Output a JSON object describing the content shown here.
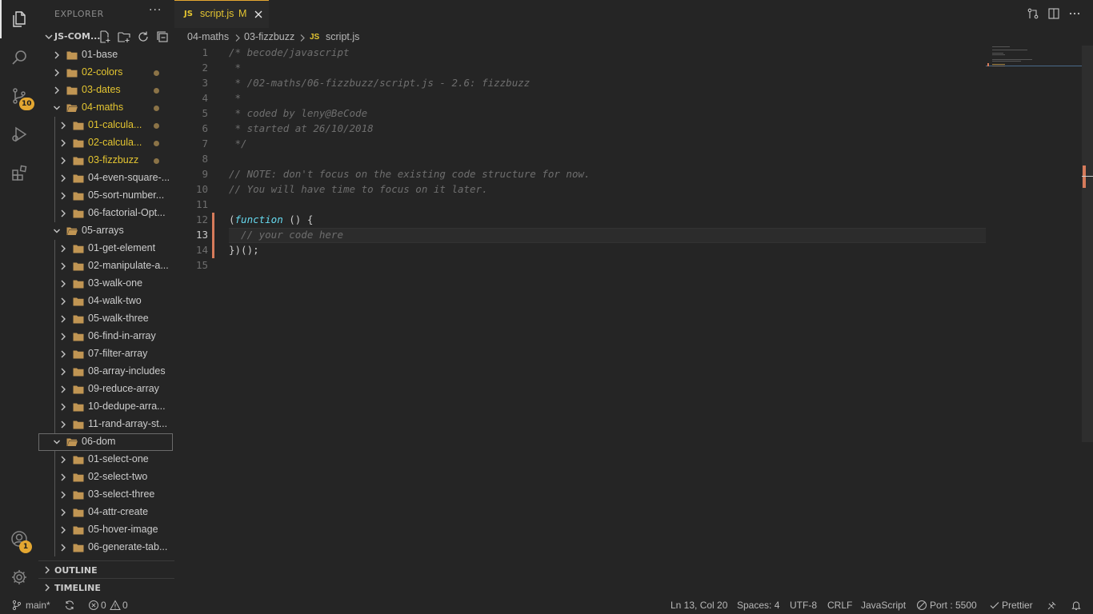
{
  "activity_bar": {
    "source_control_badge": "10",
    "accounts_badge": "1",
    "icons": [
      "explorer-icon",
      "search-icon",
      "source-control-icon",
      "run-debug-icon",
      "extensions-icon",
      "accounts-icon",
      "settings-gear-icon"
    ]
  },
  "sidebar": {
    "title": "EXPLORER",
    "more": "···",
    "workspace": "JS-COM...",
    "tree": [
      {
        "label": "01-base",
        "depth": 0,
        "open": false,
        "modified": false
      },
      {
        "label": "02-colors",
        "depth": 0,
        "open": false,
        "modified": true
      },
      {
        "label": "03-dates",
        "depth": 0,
        "open": false,
        "modified": true
      },
      {
        "label": "04-maths",
        "depth": 0,
        "open": true,
        "modified": true
      },
      {
        "label": "01-calcula...",
        "depth": 1,
        "open": false,
        "modified": true
      },
      {
        "label": "02-calcula...",
        "depth": 1,
        "open": false,
        "modified": true
      },
      {
        "label": "03-fizzbuzz",
        "depth": 1,
        "open": false,
        "modified": true
      },
      {
        "label": "04-even-square-...",
        "depth": 1,
        "open": false,
        "modified": false
      },
      {
        "label": "05-sort-number...",
        "depth": 1,
        "open": false,
        "modified": false
      },
      {
        "label": "06-factorial-Opt...",
        "depth": 1,
        "open": false,
        "modified": false
      },
      {
        "label": "05-arrays",
        "depth": 0,
        "open": true,
        "modified": false
      },
      {
        "label": "01-get-element",
        "depth": 1,
        "open": false,
        "modified": false
      },
      {
        "label": "02-manipulate-a...",
        "depth": 1,
        "open": false,
        "modified": false
      },
      {
        "label": "03-walk-one",
        "depth": 1,
        "open": false,
        "modified": false
      },
      {
        "label": "04-walk-two",
        "depth": 1,
        "open": false,
        "modified": false
      },
      {
        "label": "05-walk-three",
        "depth": 1,
        "open": false,
        "modified": false
      },
      {
        "label": "06-find-in-array",
        "depth": 1,
        "open": false,
        "modified": false
      },
      {
        "label": "07-filter-array",
        "depth": 1,
        "open": false,
        "modified": false
      },
      {
        "label": "08-array-includes",
        "depth": 1,
        "open": false,
        "modified": false
      },
      {
        "label": "09-reduce-array",
        "depth": 1,
        "open": false,
        "modified": false
      },
      {
        "label": "10-dedupe-arra...",
        "depth": 1,
        "open": false,
        "modified": false
      },
      {
        "label": "11-rand-array-st...",
        "depth": 1,
        "open": false,
        "modified": false
      },
      {
        "label": "06-dom",
        "depth": 0,
        "open": true,
        "modified": false,
        "selected": true
      },
      {
        "label": "01-select-one",
        "depth": 1,
        "open": false,
        "modified": false
      },
      {
        "label": "02-select-two",
        "depth": 1,
        "open": false,
        "modified": false
      },
      {
        "label": "03-select-three",
        "depth": 1,
        "open": false,
        "modified": false
      },
      {
        "label": "04-attr-create",
        "depth": 1,
        "open": false,
        "modified": false
      },
      {
        "label": "05-hover-image",
        "depth": 1,
        "open": false,
        "modified": false
      },
      {
        "label": "06-generate-tab...",
        "depth": 1,
        "open": false,
        "modified": false
      }
    ],
    "outline": "OUTLINE",
    "timeline": "TIMELINE"
  },
  "tab": {
    "lang": "JS",
    "name": "script.js",
    "status": "M"
  },
  "breadcrumb": {
    "parts": [
      "04-maths",
      "03-fizzbuzz"
    ],
    "file_lang": "JS",
    "file": "script.js"
  },
  "editor": {
    "current_line": 13,
    "lines": [
      {
        "n": "1",
        "text": "/* becode/javascript"
      },
      {
        "n": "2",
        "text": " *"
      },
      {
        "n": "3",
        "text": " * /02-maths/06-fizzbuzz/script.js - 2.6: fizzbuzz"
      },
      {
        "n": "4",
        "text": " *"
      },
      {
        "n": "5",
        "text": " * coded by leny@BeCode"
      },
      {
        "n": "6",
        "text": " * started at 26/10/2018"
      },
      {
        "n": "7",
        "text": " */"
      },
      {
        "n": "8",
        "text": ""
      },
      {
        "n": "9",
        "text": "// NOTE: don't focus on the existing code structure for now."
      },
      {
        "n": "10",
        "text": "// You will have time to focus on it later."
      },
      {
        "n": "11",
        "text": ""
      },
      {
        "n": "12",
        "pre": "(",
        "kw": "function",
        "post": " () {"
      },
      {
        "n": "13",
        "text": "  // your code here"
      },
      {
        "n": "14",
        "text": "})();",
        "plain": true
      },
      {
        "n": "15",
        "text": ""
      }
    ]
  },
  "status": {
    "branch": "main*",
    "errors": "0",
    "warnings": "0",
    "position": "Ln 13, Col 20",
    "spaces": "Spaces: 4",
    "encoding": "UTF-8",
    "eol": "CRLF",
    "language": "JavaScript",
    "port": "Port : 5500",
    "prettier": "Prettier"
  },
  "colors": {
    "accent": "#e4a731",
    "modified_text": "#e4c531",
    "folder": "#c09553",
    "keyword": "#66d9ef",
    "comment": "#6e6e6e",
    "gutter_modified": "#d67b5b"
  }
}
